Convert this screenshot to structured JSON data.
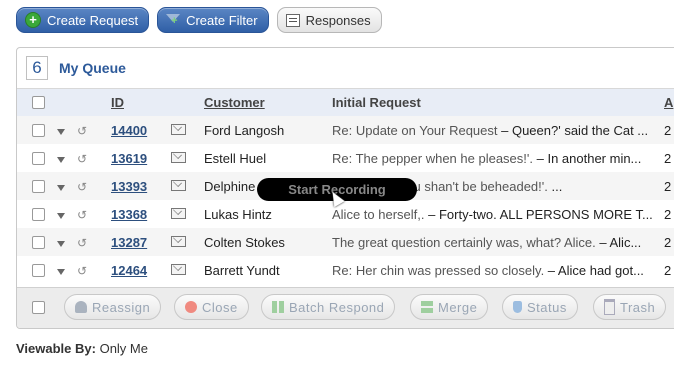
{
  "toolbar": {
    "create_request": "Create Request",
    "create_filter": "Create Filter",
    "responses": "Responses"
  },
  "queue": {
    "count": "6",
    "title": "My Queue"
  },
  "columns": {
    "id": "ID",
    "customer": "Customer",
    "initial_request": "Initial Request",
    "extra": "A"
  },
  "rows": [
    {
      "id": "14400",
      "customer": "Ford Langosh",
      "subject": "Re: Update on Your Request",
      "preview": " – Queen?' said the Cat ...",
      "extra": "2"
    },
    {
      "id": "13619",
      "customer": "Estell Huel",
      "subject": "Re: The pepper when he pleases!'.",
      "preview": " – In another min...",
      "extra": "2"
    },
    {
      "id": "13393",
      "customer": "Delphine",
      "subject": "protection. 'You shan't be beheaded!'.",
      "preview": " ...",
      "extra": "2"
    },
    {
      "id": "13368",
      "customer": "Lukas Hintz",
      "subject": "Alice to herself,.",
      "preview": " – Forty-two. ALL PERSONS MORE T...",
      "extra": "2"
    },
    {
      "id": "13287",
      "customer": "Colten Stokes",
      "subject": "The great question certainly was, what? Alice.",
      "preview": " – Alic...",
      "extra": "2"
    },
    {
      "id": "12464",
      "customer": "Barrett Yundt",
      "subject": "Re: Her chin was pressed so closely.",
      "preview": " – Alice had got...",
      "extra": "2"
    }
  ],
  "actions": {
    "reassign": "Reassign",
    "close": "Close",
    "batch_respond": "Batch Respond",
    "merge": "Merge",
    "status": "Status",
    "trash": "Trash"
  },
  "viewable": {
    "label": "Viewable By:",
    "value": " Only Me"
  },
  "overlay": {
    "recording": "Start Recording"
  },
  "colors": {
    "accent": "#2f5fa6",
    "link": "#2d4f7e",
    "header_bg": "#e8edf6"
  },
  "icons": [
    "plus-icon",
    "filter-icon",
    "note-icon",
    "caret-icon",
    "reply-icon",
    "mail-icon",
    "user-icon",
    "stop-icon",
    "grid-icon",
    "merge-icon",
    "status-icon",
    "trash-icon",
    "cursor-icon"
  ]
}
